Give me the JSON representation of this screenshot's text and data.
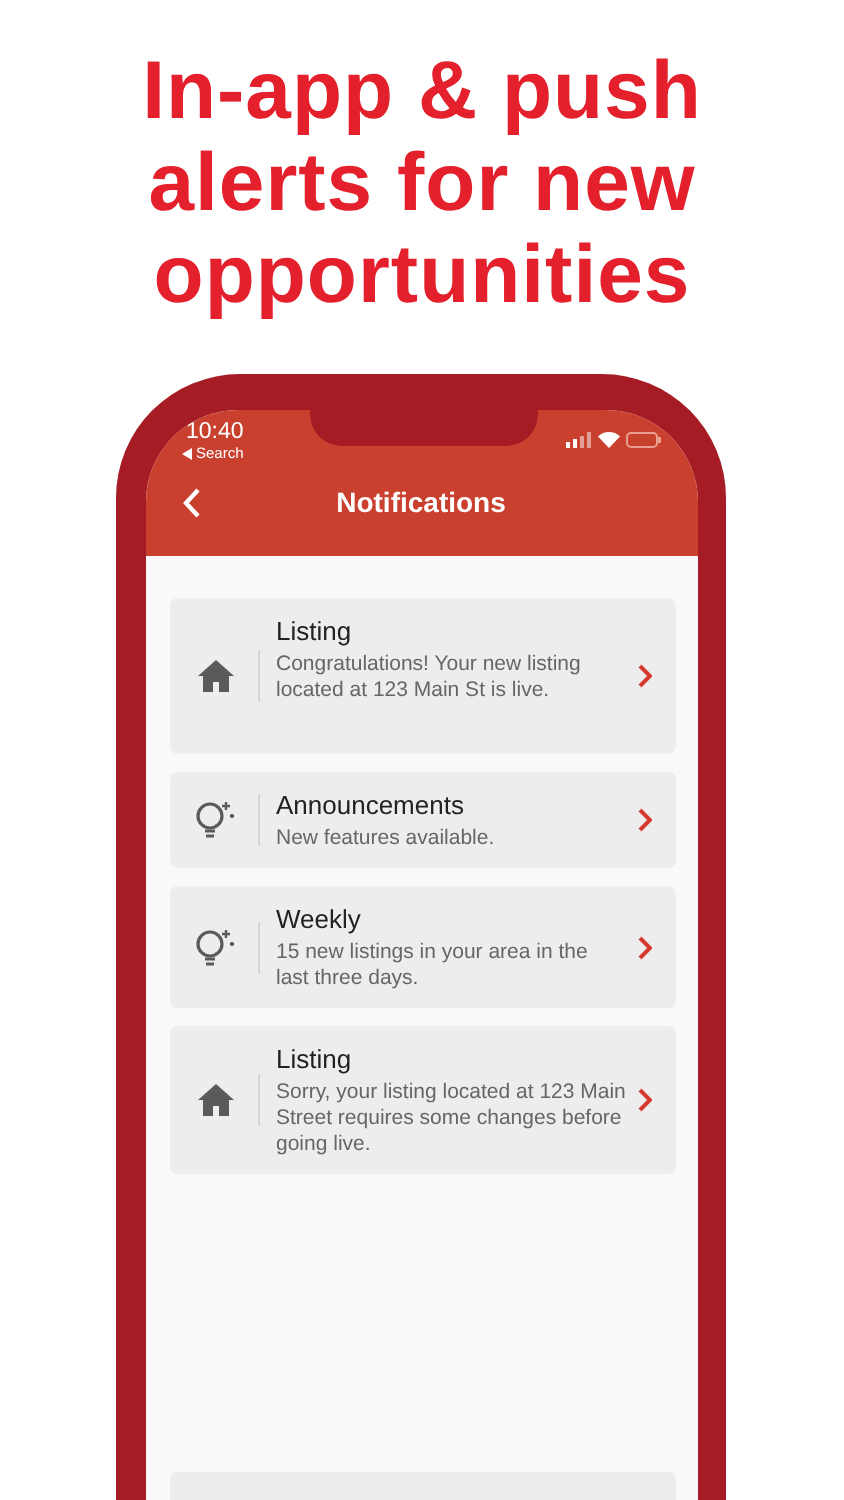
{
  "headline": [
    "In-app & push",
    "alerts for new",
    "opportunities"
  ],
  "status_bar": {
    "time": "10:40",
    "back_label": "Search"
  },
  "header": {
    "title": "Notifications"
  },
  "notifications": [
    {
      "kind": "house",
      "title": "Listing",
      "message": "Congratulations! Your new listing located at 123 Main St is live.",
      "tall": true
    },
    {
      "kind": "bulb",
      "title": "Announcements",
      "message": "New features available.",
      "tall": false
    },
    {
      "kind": "bulb",
      "title": "Weekly",
      "message": "15 new listings in your area in the last three days.",
      "tall": false
    },
    {
      "kind": "house",
      "title": "Listing",
      "message": "Sorry, your listing located at 123 Main Street requires some changes before going live.",
      "tall": false
    }
  ]
}
